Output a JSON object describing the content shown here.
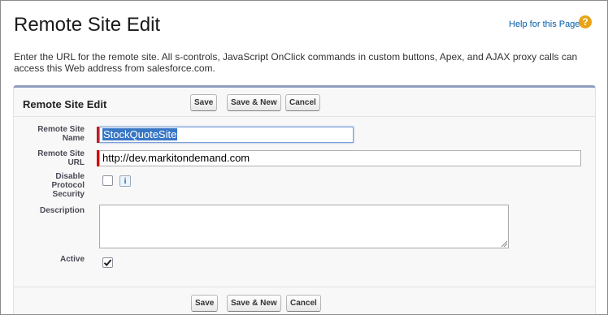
{
  "page": {
    "title": "Remote Site Edit",
    "help_link": "Help for this Page",
    "help_icon_glyph": "?",
    "intro": "Enter the URL for the remote site. All s-controls, JavaScript OnClick commands in custom buttons, Apex, and AJAX proxy calls can access this Web address from salesforce.com."
  },
  "panel": {
    "title": "Remote Site Edit",
    "buttons": {
      "save": "Save",
      "save_new": "Save & New",
      "cancel": "Cancel"
    }
  },
  "fields": {
    "name": {
      "label_line1": "Remote Site",
      "label_line2": "Name",
      "value": "StockQuoteSite",
      "required": true
    },
    "url": {
      "label_line1": "Remote Site",
      "label_line2": "URL",
      "value": "http://dev.markitondemand.com",
      "required": true
    },
    "disable_security": {
      "label_line1": "Disable",
      "label_line2": "Protocol",
      "label_line3": "Security",
      "checked": false,
      "info_glyph": "i"
    },
    "description": {
      "label": "Description",
      "value": ""
    },
    "active": {
      "label": "Active",
      "checked": true
    }
  },
  "colors": {
    "required_bar": "#cc0000",
    "link": "#015ba7",
    "panel_accent": "#8e9dbe",
    "help_icon": "#e8a317"
  }
}
